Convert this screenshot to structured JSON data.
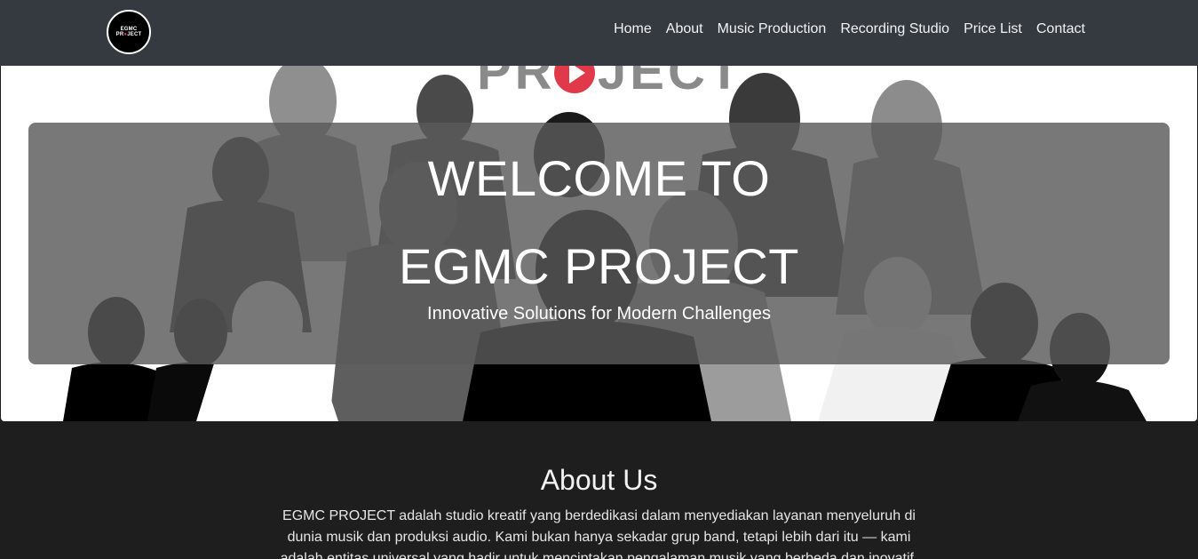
{
  "navbar": {
    "logo": {
      "line1": "EGMC",
      "line2_a": "PR",
      "line2_dot": "●",
      "line2_b": "JECT"
    },
    "links": [
      "Home",
      "About",
      "Music Production",
      "Recording Studio",
      "Price List",
      "Contact"
    ]
  },
  "hero": {
    "background_logo_text": "PR  JECT",
    "title_line1": "WELCOME TO",
    "title_line2": "EGMC PROJECT",
    "subtitle": "Innovative Solutions for Modern Challenges"
  },
  "about": {
    "title": "About Us",
    "text": "EGMC PROJECT adalah studio kreatif yang berdedikasi dalam menyediakan layanan menyeluruh di dunia musik dan produksi audio. Kami bukan hanya sekadar grup band, tetapi lebih dari itu — kami adalah entitas universal yang hadir untuk menciptakan pengalaman musik yang berbeda dan inovatif."
  },
  "colors": {
    "navbar_bg": "#343a40",
    "page_bg": "#1e1e1f",
    "accent_red": "#e03a4a"
  }
}
